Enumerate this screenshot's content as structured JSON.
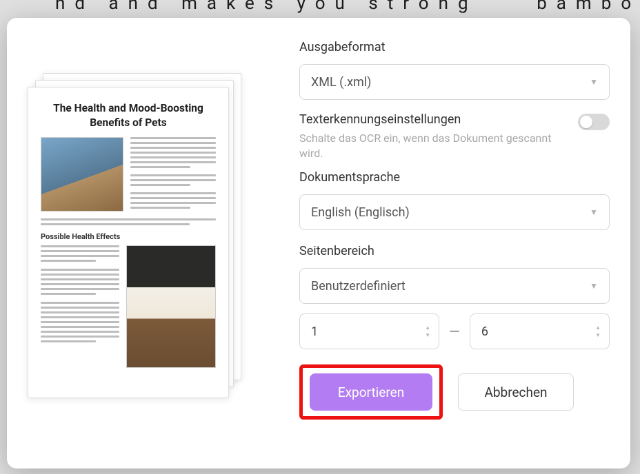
{
  "backdrop": {
    "line1": "nd and makes you stronger. It is also",
    "line2": "bamboo"
  },
  "preview": {
    "title": "The Health and Mood-Boosting Benefits of Pets",
    "subhead": "Possible Health Effects"
  },
  "form": {
    "output_label": "Ausgabeformat",
    "output_value": "XML (.xml)",
    "ocr_label": "Texterkennungseinstellungen",
    "ocr_hint": "Schalte das OCR ein, wenn das Dokument gescannt wird.",
    "lang_label": "Dokumentsprache",
    "lang_value": "English (Englisch)",
    "range_label": "Seitenbereich",
    "range_value": "Benutzerdefiniert",
    "page_from": "1",
    "page_to": "6",
    "export": "Exportieren",
    "cancel": "Abbrechen"
  }
}
